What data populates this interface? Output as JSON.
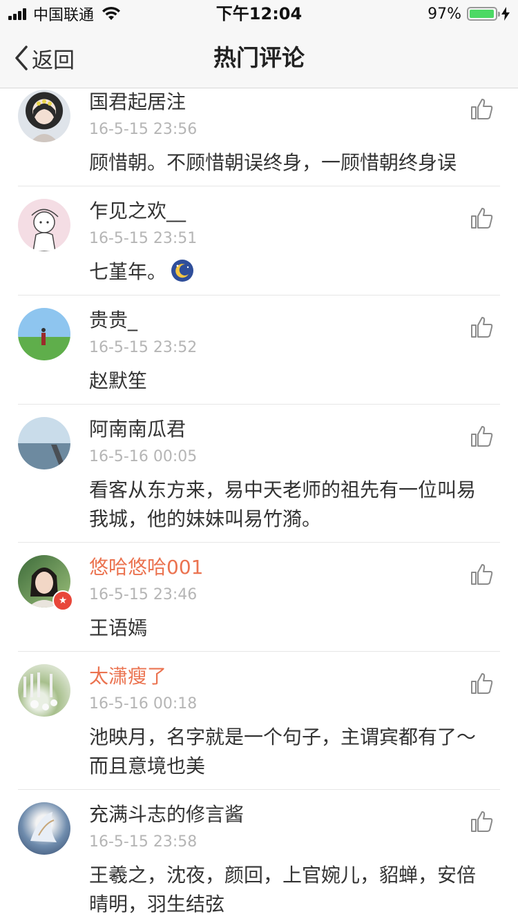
{
  "status_bar": {
    "carrier": "中国联通",
    "time": "下午12:04",
    "battery_pct": "97%",
    "battery_level": 0.97,
    "icons": [
      "signal-bars-icon",
      "wifi-icon",
      "battery-icon",
      "charging-bolt-icon"
    ]
  },
  "nav": {
    "back_label": "返回",
    "title": "热门评论"
  },
  "colors": {
    "vip_name": "#eb7350",
    "timestamp": "#b5b5b5",
    "text": "#333333",
    "battery_fill": "#4cd964"
  },
  "comments": [
    {
      "name": "国君起居注",
      "time": "16-5-15 23:56",
      "text": "顾惜朝。不顾惜朝误终身，一顾惜朝终身误",
      "vip": false
    },
    {
      "name": "乍见之欢__",
      "time": "16-5-15 23:51",
      "text": "七堇年。",
      "vip": false,
      "emoji": "moon-emoji"
    },
    {
      "name": "贵贵_",
      "time": "16-5-15 23:52",
      "text": "赵默笙",
      "vip": false
    },
    {
      "name": "阿南南瓜君",
      "time": "16-5-16 00:05",
      "text": "看客从东方来，易中天老师的祖先有一位叫易我城，他的妹妹叫易竹漪。",
      "vip": false
    },
    {
      "name": "悠哈悠哈001",
      "time": "16-5-15 23:46",
      "text": "王语嫣",
      "vip": true
    },
    {
      "name": "太潇瘦了",
      "time": "16-5-16 00:18",
      "text": "池映月，名字就是一个句子，主谓宾都有了～而且意境也美",
      "vip": true
    },
    {
      "name": "充满斗志的修言酱",
      "time": "16-5-15 23:58",
      "text": "王羲之，沈夜，颜回，上官婉儿，貂蝉，安倍晴明，羽生结弦",
      "vip": false
    }
  ]
}
